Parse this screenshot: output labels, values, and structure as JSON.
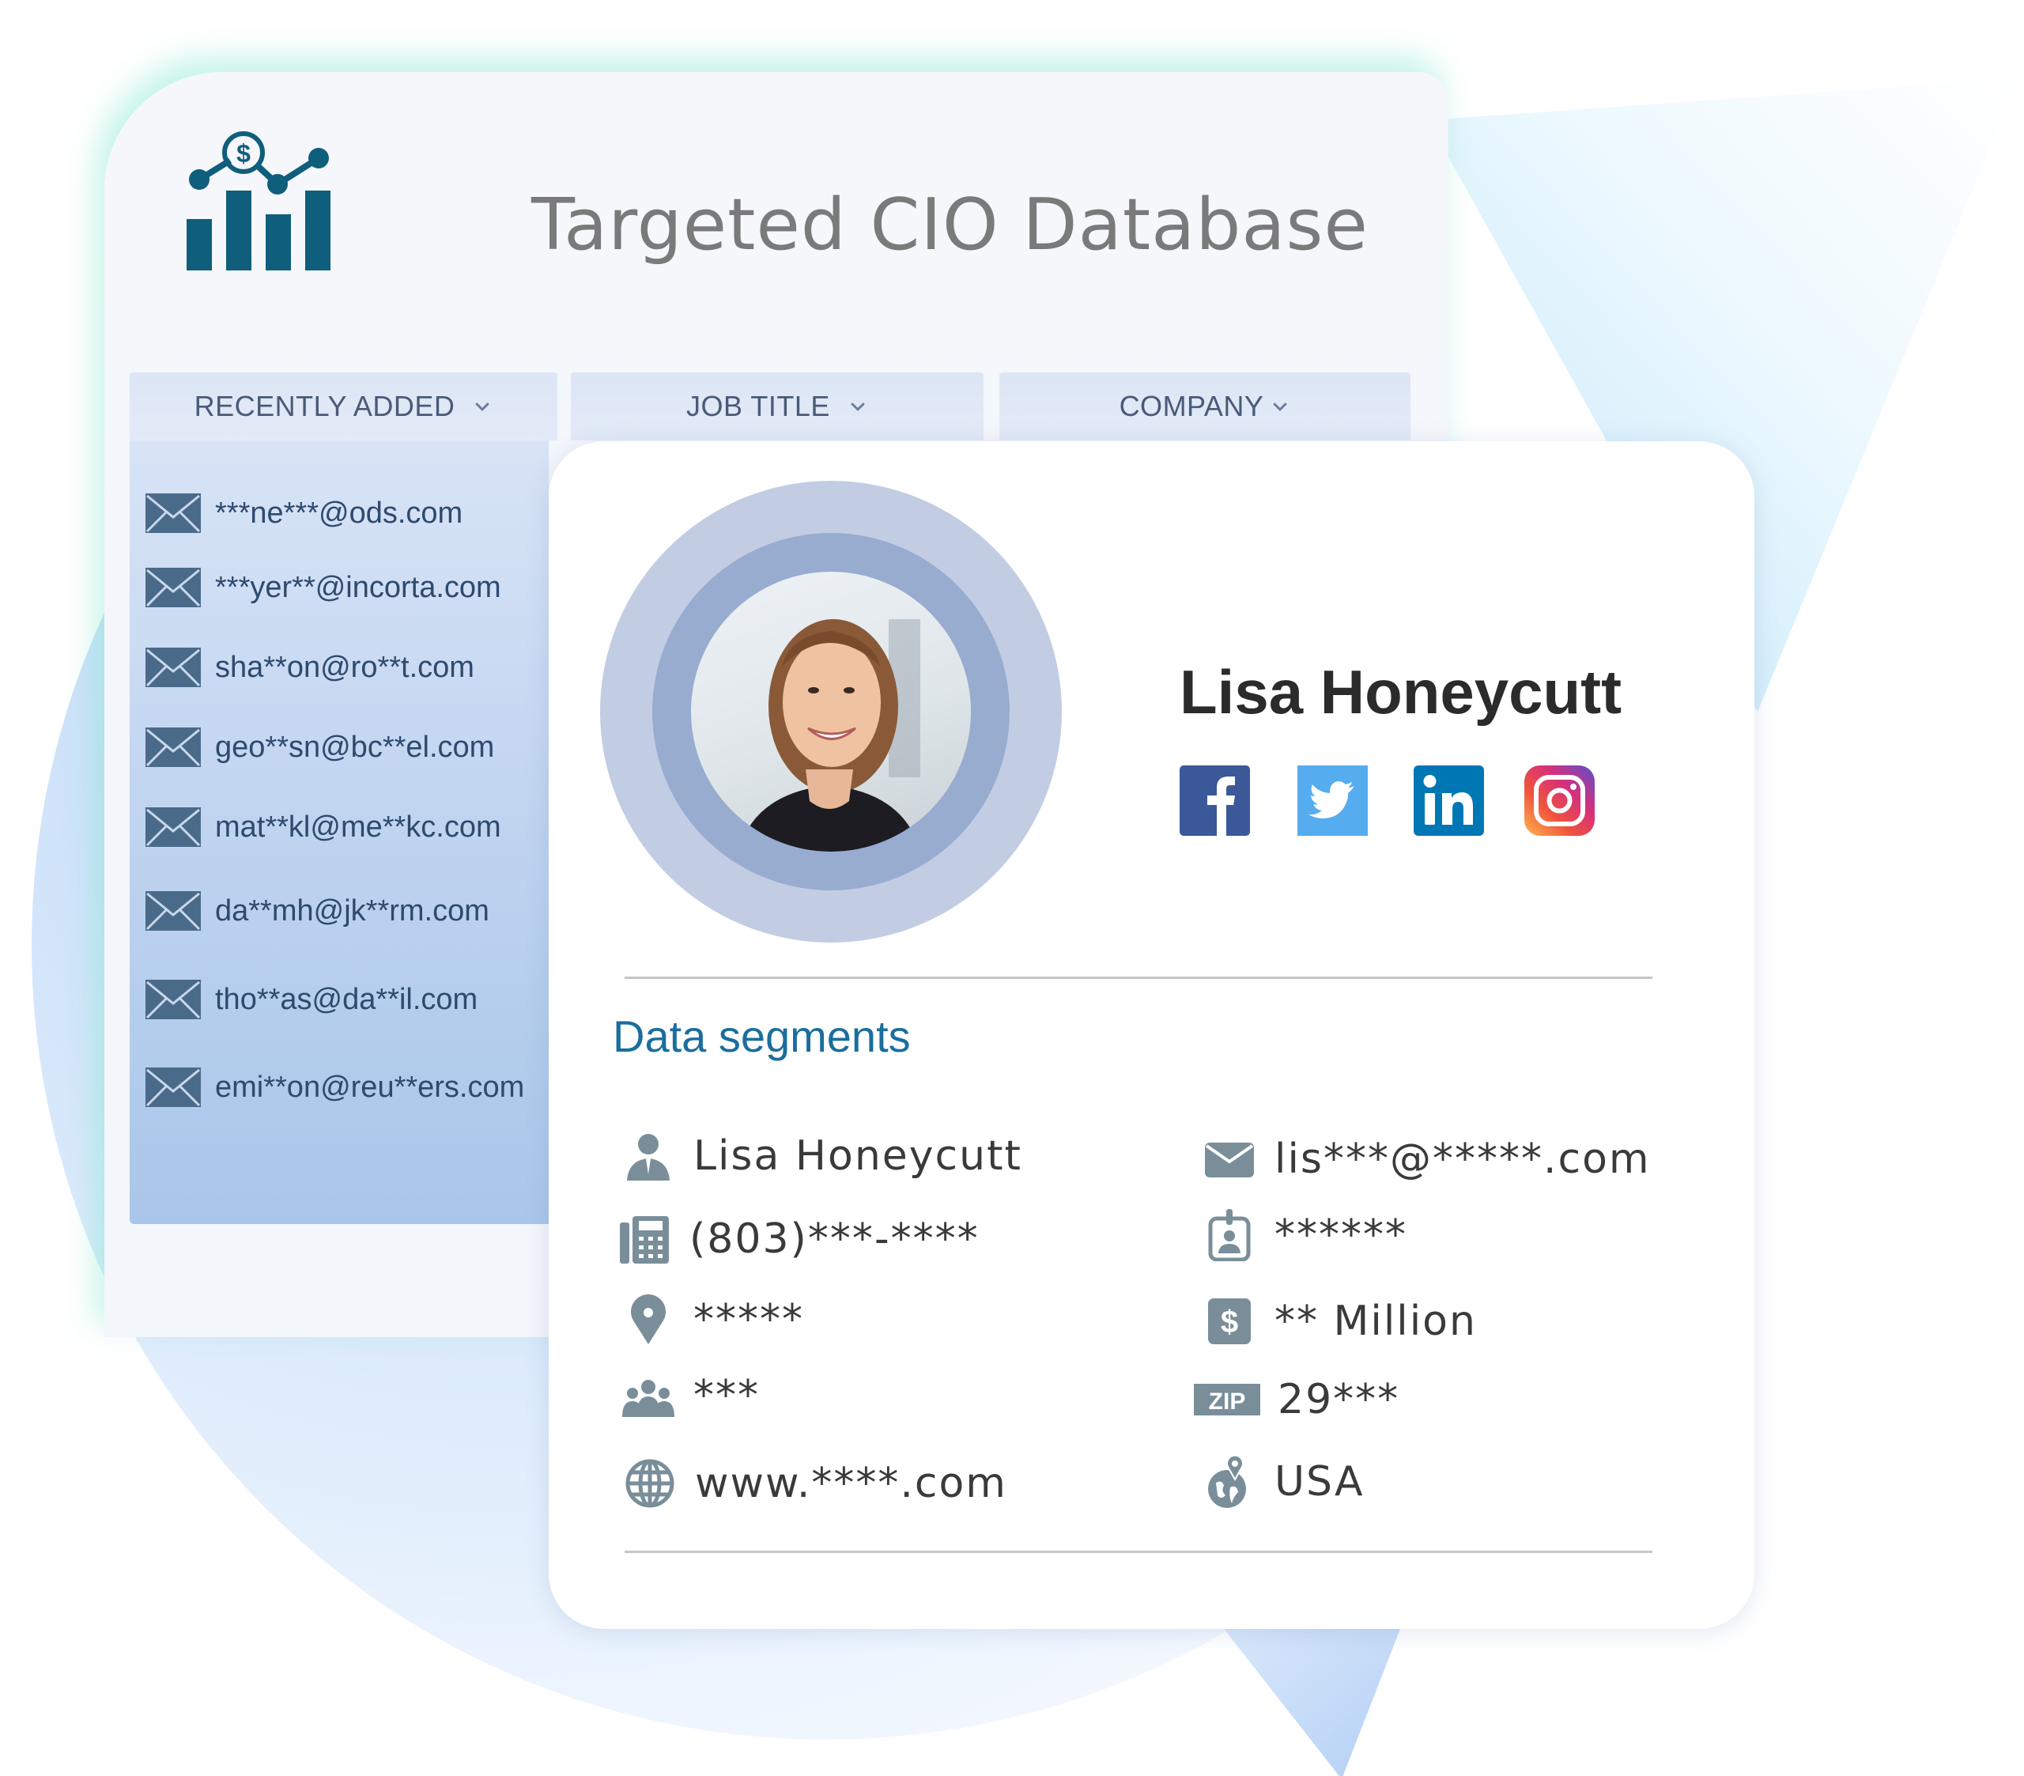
{
  "header": {
    "title": "Targeted CIO Database",
    "logo_icon": "chart-dollar-icon"
  },
  "tabs": [
    {
      "label": "RECENTLY ADDED",
      "icon": "chevron-down-icon"
    },
    {
      "label": "JOB TITLE",
      "icon": "chevron-down-icon"
    },
    {
      "label": "COMPANY",
      "icon": "chevron-down-icon"
    }
  ],
  "recent_emails": [
    "***ne***@ods.com",
    "***yer**@incorta.com",
    "sha**on@ro**t.com",
    "geo**sn@bc**el.com",
    "mat**kl@me**kc.com",
    "da**mh@jk**rm.com",
    "tho**as@da**il.com",
    "emi**on@reu**ers.com"
  ],
  "profile": {
    "name": "Lisa Honeycutt",
    "avatar": "profile-photo",
    "social": [
      {
        "name": "Facebook",
        "icon": "facebook-icon",
        "color": "#3b5998"
      },
      {
        "name": "Twitter",
        "icon": "twitter-icon",
        "color": "#55acee"
      },
      {
        "name": "LinkedIn",
        "icon": "linkedin-icon",
        "color": "#0077b5"
      },
      {
        "name": "Instagram",
        "icon": "instagram-icon",
        "color": "#c13584"
      }
    ]
  },
  "segments": {
    "title": "Data segments",
    "left": [
      {
        "icon": "person-icon",
        "value": "Lisa Honeycutt"
      },
      {
        "icon": "phone-icon",
        "value": "(803)***-****"
      },
      {
        "icon": "location-pin-icon",
        "value": "*****"
      },
      {
        "icon": "team-icon",
        "value": "***"
      },
      {
        "icon": "globe-icon",
        "value": "www.****.com"
      }
    ],
    "right": [
      {
        "icon": "email-icon",
        "value": "lis***@*****.com"
      },
      {
        "icon": "id-badge-icon",
        "value": "******"
      },
      {
        "icon": "dollar-icon",
        "value": "** Million"
      },
      {
        "icon": "zip-icon",
        "value": "29***",
        "badge": "ZIP"
      },
      {
        "icon": "globe-pin-icon",
        "value": "USA"
      }
    ]
  },
  "colors": {
    "accent": "#1a6e9e",
    "logo": "#0f5e7c",
    "icon_gray": "#7a8e9a",
    "email_icon": "#4a6a8a"
  }
}
